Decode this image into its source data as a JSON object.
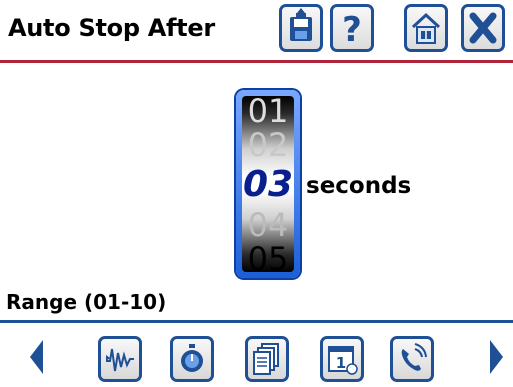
{
  "header": {
    "title": "Auto Stop After",
    "buttons": [
      {
        "icon": "save-icon"
      },
      {
        "icon": "help-icon",
        "label": "?"
      },
      {
        "icon": "home-icon"
      },
      {
        "icon": "close-icon"
      }
    ]
  },
  "picker": {
    "values": [
      "01",
      "02",
      "03",
      "04",
      "05"
    ],
    "selected": "03",
    "unit": "seconds"
  },
  "range_label": "Range (01-10)",
  "footer": {
    "nav_left_icon": "left-arrow-icon",
    "nav_right_icon": "right-arrow-icon",
    "buttons": [
      {
        "icon": "waveform-icon"
      },
      {
        "icon": "stopwatch-icon"
      },
      {
        "icon": "documents-icon"
      },
      {
        "icon": "calendar-icon",
        "label": "1"
      },
      {
        "icon": "phone-icon"
      }
    ]
  },
  "colors": {
    "accent_blue": "#1f4f95",
    "header_red": "#b0243a",
    "selected_text": "#0a1f8f"
  }
}
